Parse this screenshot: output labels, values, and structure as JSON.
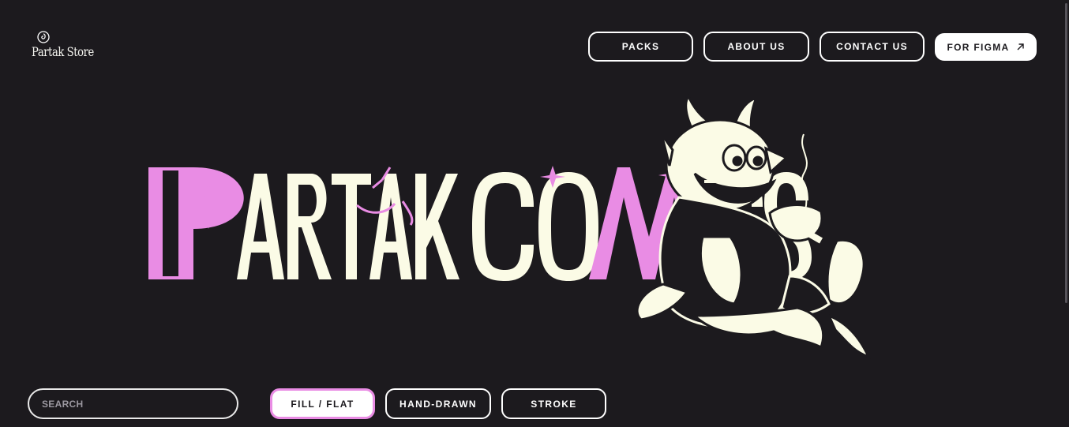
{
  "header": {
    "logo_text": "Partak Store",
    "nav": [
      {
        "label": "PACKS"
      },
      {
        "label": "ABOUT US"
      },
      {
        "label": "CONTACT US"
      },
      {
        "label": "FOR FIGMA",
        "icon": "arrow-up-right-icon"
      }
    ]
  },
  "hero": {
    "wordmark_line1": "PARTAK",
    "wordmark_line2": "COMICS",
    "illustration": "devil-cartoon-character-smoking-icon",
    "colors": {
      "cream": "#fbfbe6",
      "pink": "#e98ce4",
      "background": "#1c1a1e"
    }
  },
  "search": {
    "placeholder": "SEARCH",
    "value": ""
  },
  "filters": [
    {
      "label": "FILL / FLAT",
      "selected": true
    },
    {
      "label": "HAND-DRAWN",
      "selected": false
    },
    {
      "label": "STROKE",
      "selected": false
    }
  ],
  "colors": {
    "accent": "#e98ce4",
    "background": "#1c1a1e",
    "text": "#ffffff"
  }
}
